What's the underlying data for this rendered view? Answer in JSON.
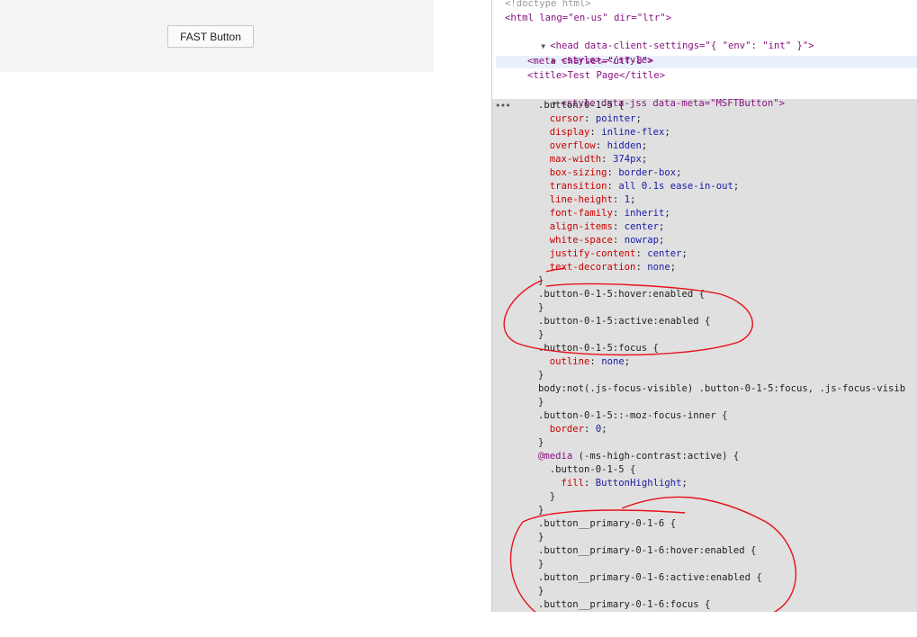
{
  "page": {
    "button_label": "FAST Button"
  },
  "devtools": {
    "ellipsis": "•••",
    "html_lines": {
      "doctype": "<!doctype html>",
      "html_open": "<html lang=\"en-us\" dir=\"ltr\">",
      "head_open": "<head data-client-settings=\"{ \"env\": \"int\" }\">",
      "style_collapsed": "<style>…</style>",
      "meta": "<meta charset=\"utf-8\">",
      "title": "<title>Test Page</title>",
      "style_jss": "<style data-jss data-meta=\"MSFTButton\">"
    },
    "css_lines": [
      ".button-0-1-5 {",
      "  cursor: pointer;",
      "  display: inline-flex;",
      "  overflow: hidden;",
      "  max-width: 374px;",
      "  box-sizing: border-box;",
      "  transition: all 0.1s ease-in-out;",
      "  line-height: 1;",
      "  font-family: inherit;",
      "  align-items: center;",
      "  white-space: nowrap;",
      "  justify-content: center;",
      "  text-decoration: none;",
      "}",
      ".button-0-1-5:hover:enabled {",
      "}",
      ".button-0-1-5:active:enabled {",
      "}",
      ".button-0-1-5:focus {",
      "  outline: none;",
      "}",
      "body:not(.js-focus-visible) .button-0-1-5:focus, .js-focus-visib",
      "}",
      ".button-0-1-5::-moz-focus-inner {",
      "  border: 0;",
      "}",
      "@media (-ms-high-contrast:active) {",
      "  .button-0-1-5 {",
      "    fill: ButtonHighlight;",
      "  }",
      "}",
      ".button__primary-0-1-6 {",
      "}",
      ".button__primary-0-1-6:hover:enabled {",
      "}",
      ".button__primary-0-1-6:active:enabled {",
      "}",
      ".button__primary-0-1-6:focus {"
    ]
  },
  "colors": {
    "annotation": "#e8101a",
    "selected_bg": "#e0e0e0",
    "tag": "#881280",
    "property": "#c80000"
  }
}
